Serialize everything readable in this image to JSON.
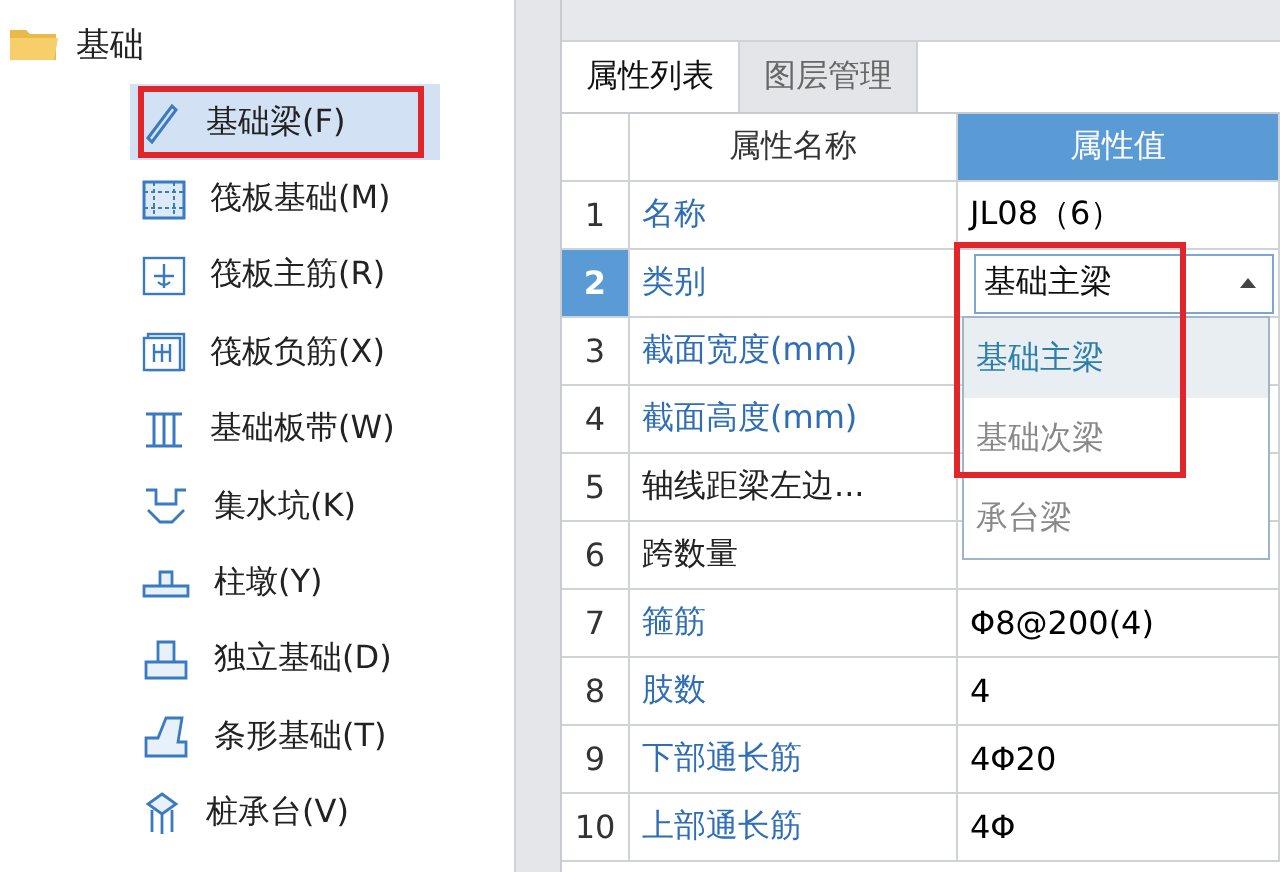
{
  "tree": {
    "label": "基础",
    "expanded": true,
    "items": [
      {
        "label": "基础梁(F)",
        "selected": true,
        "highlighted": true
      },
      {
        "label": "筏板基础(M)",
        "selected": false,
        "highlighted": false
      },
      {
        "label": "筏板主筋(R)",
        "selected": false,
        "highlighted": false
      },
      {
        "label": "筏板负筋(X)",
        "selected": false,
        "highlighted": false
      },
      {
        "label": "基础板带(W)",
        "selected": false,
        "highlighted": false
      },
      {
        "label": "集水坑(K)",
        "selected": false,
        "highlighted": false
      },
      {
        "label": "柱墩(Y)",
        "selected": false,
        "highlighted": false
      },
      {
        "label": "独立基础(D)",
        "selected": false,
        "highlighted": false
      },
      {
        "label": "条形基础(T)",
        "selected": false,
        "highlighted": false
      },
      {
        "label": "桩承台(V)",
        "selected": false,
        "highlighted": false
      }
    ]
  },
  "tabs": [
    {
      "label": "属性列表",
      "selected": true
    },
    {
      "label": "图层管理",
      "selected": false
    }
  ],
  "table": {
    "columns": [
      "属性名称",
      "属性值"
    ],
    "rows": [
      {
        "number": "1",
        "name": "名称",
        "name_link": true,
        "value": "JL08（6）",
        "selected": false
      },
      {
        "number": "2",
        "name": "类别",
        "name_link": true,
        "value": "基础主梁",
        "selected": true
      },
      {
        "number": "3",
        "name": "截面宽度(mm)",
        "name_link": true,
        "selected": false
      },
      {
        "number": "4",
        "name": "截面高度(mm)",
        "name_link": true,
        "selected": false
      },
      {
        "number": "5",
        "name": "轴线距梁左边...",
        "name_link": false,
        "selected": false
      },
      {
        "number": "6",
        "name": "跨数量",
        "name_link": false,
        "selected": false
      },
      {
        "number": "7",
        "name": "箍筋",
        "name_link": true,
        "value": "Φ8@200(4)",
        "selected": false
      },
      {
        "number": "8",
        "name": "肢数",
        "name_link": true,
        "value": "4",
        "selected": false
      },
      {
        "number": "9",
        "name": "下部通长筋",
        "name_link": true,
        "value": "4Φ20",
        "selected": false
      },
      {
        "number": "10",
        "name": "上部通长筋",
        "name_link": true,
        "value": "4Φ",
        "selected": false
      }
    ]
  },
  "dropdown": {
    "highlighted": true,
    "options": [
      {
        "label": "基础主梁",
        "selected": true
      },
      {
        "label": "基础次梁",
        "selected": false
      },
      {
        "label": "承台梁",
        "selected": false
      }
    ]
  }
}
